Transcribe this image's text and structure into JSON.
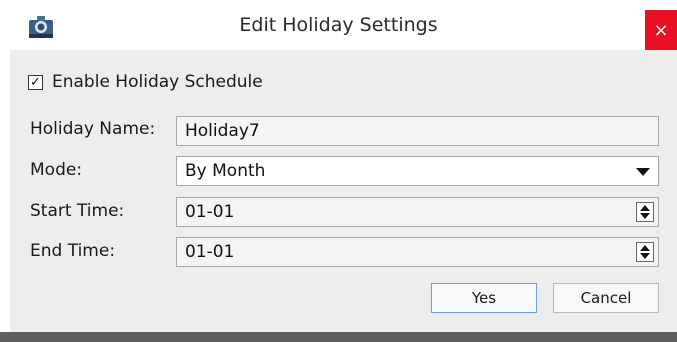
{
  "window": {
    "title": "Edit Holiday Settings",
    "close_glyph": "×",
    "icon": "camera-app-icon",
    "close_color": "#e81123"
  },
  "form": {
    "enable_checkbox": {
      "label": "Enable Holiday Schedule",
      "checked": true,
      "mark": "✓"
    },
    "holiday_name": {
      "label": "Holiday Name:",
      "value": "Holiday7"
    },
    "mode": {
      "label": "Mode:",
      "value": "By Month"
    },
    "start_time": {
      "label": "Start Time:",
      "value": "01-01"
    },
    "end_time": {
      "label": "End Time:",
      "value": "01-01"
    }
  },
  "buttons": {
    "yes": "Yes",
    "cancel": "Cancel"
  }
}
